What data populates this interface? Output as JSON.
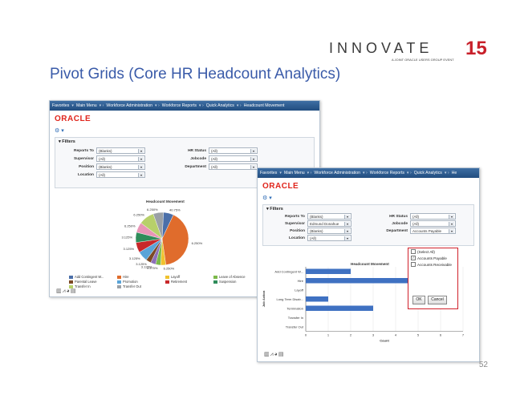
{
  "slide": {
    "title": "Pivot Grids (Core HR Headcount Analytics)",
    "page_number": "52"
  },
  "logo": {
    "main_text": "INNOVATE",
    "year": "15",
    "tagline": "A JOINT ORACLE USERS GROUP EVENT",
    "colors": {
      "dark": "#3a3a3a",
      "accent": "#c8202a"
    }
  },
  "screen1": {
    "nav": [
      "Favorites",
      "Main Menu",
      "Workforce Administration",
      "Workforce Reports",
      "Quick Analytics",
      "Headcount Movement"
    ],
    "brand": "ORACLE",
    "filters_label": "Filters",
    "filters": [
      {
        "label": "Reports To",
        "value": "(Blanks)"
      },
      {
        "label": "Supervisor",
        "value": "(All)"
      },
      {
        "label": "Position",
        "value": "(Blanks)"
      },
      {
        "label": "Location",
        "value": "(All)"
      },
      {
        "label": "HR Status",
        "value": "(All)"
      },
      {
        "label": "Jobcode",
        "value": "(All)"
      },
      {
        "label": "Department",
        "value": "(All)"
      }
    ],
    "chart_title": "Headcount Movement",
    "legend": [
      {
        "label": "Add Contingent W...",
        "color": "#4b6fa9"
      },
      {
        "label": "Hire",
        "color": "#e06c2c"
      },
      {
        "label": "Layoff",
        "color": "#f0c22e"
      },
      {
        "label": "Leave of Absence",
        "color": "#7cb94a"
      },
      {
        "label": "Long Term Disab",
        "color": "#8c6fb8"
      },
      {
        "label": "Parental Leave",
        "color": "#7c4a25"
      },
      {
        "label": "Promotion",
        "color": "#5aa4d8"
      },
      {
        "label": "Retirement",
        "color": "#c8282a"
      },
      {
        "label": "Suspension",
        "color": "#2f8c5a"
      },
      {
        "label": "Termination",
        "color": "#e895b6"
      },
      {
        "label": "Transfer In",
        "color": "#b7d06a"
      },
      {
        "label": "Transfer Out",
        "color": "#9aa0a6"
      }
    ]
  },
  "screen2": {
    "nav": [
      "Favorites",
      "Main Menu",
      "Workforce Administration",
      "Workforce Reports",
      "Quick Analytics",
      "He"
    ],
    "brand": "ORACLE",
    "filters_label": "Filters",
    "filters": [
      {
        "label": "Reports To",
        "value": "(Blanks)"
      },
      {
        "label": "Supervisor",
        "value": "Edmund Donahue"
      },
      {
        "label": "Position",
        "value": "(Blanks)"
      },
      {
        "label": "Location",
        "value": "(All)"
      },
      {
        "label": "HR Status",
        "value": "(All)"
      },
      {
        "label": "Jobcode",
        "value": "(All)"
      },
      {
        "label": "Department",
        "value": "Accounts Payable"
      }
    ],
    "dropdown_options": [
      {
        "label": "(Select All)",
        "checked": false
      },
      {
        "label": "Accounts Payable",
        "checked": true
      },
      {
        "label": "Accounts Receivable",
        "checked": false
      }
    ],
    "ok_label": "OK",
    "cancel_label": "Cancel",
    "chart_title": "Headcount Movement"
  },
  "chart_data": [
    {
      "type": "pie",
      "title": "Headcount Movement",
      "series": [
        {
          "name": "Add Contingent W...",
          "value": 6.25
        },
        {
          "name": "Hire",
          "value": 40.75
        },
        {
          "name": "Layoff",
          "value": 3.125
        },
        {
          "name": "Leave of Absence",
          "value": 3.125
        },
        {
          "name": "Long Term Disab",
          "value": 3.125
        },
        {
          "name": "Parental Leave",
          "value": 3.125
        },
        {
          "name": "Promotion",
          "value": 6.25
        },
        {
          "name": "Retirement",
          "value": 6.25
        },
        {
          "name": "Suspension",
          "value": 6.25
        },
        {
          "name": "Termination",
          "value": 6.25
        },
        {
          "name": "Transfer In",
          "value": 9.375
        },
        {
          "name": "Transfer Out",
          "value": 6.25
        }
      ],
      "data_labels": [
        "40.75%",
        "6.250%",
        "6.250%",
        "9.375%",
        "3.125%",
        "3.125%",
        "3.125%",
        "3.125%",
        "3.125%",
        "6.250%",
        "6.250%",
        "6.250%"
      ]
    },
    {
      "type": "bar",
      "orientation": "horizontal",
      "title": "Headcount Movement",
      "categories": [
        "Add Contingent W...",
        "Hire",
        "Layoff",
        "Long Term Disab...",
        "Termination",
        "Transfer In",
        "Transfer Out"
      ],
      "values": [
        2,
        5,
        0,
        1,
        3,
        0,
        0
      ],
      "xlabel": "Count",
      "ylabel": "Job Action",
      "xlim": [
        0,
        7
      ],
      "xticks": [
        "0",
        "1",
        "2",
        "3",
        "4",
        "5",
        "6",
        "7"
      ],
      "bar_color": "#3f71c2"
    }
  ]
}
